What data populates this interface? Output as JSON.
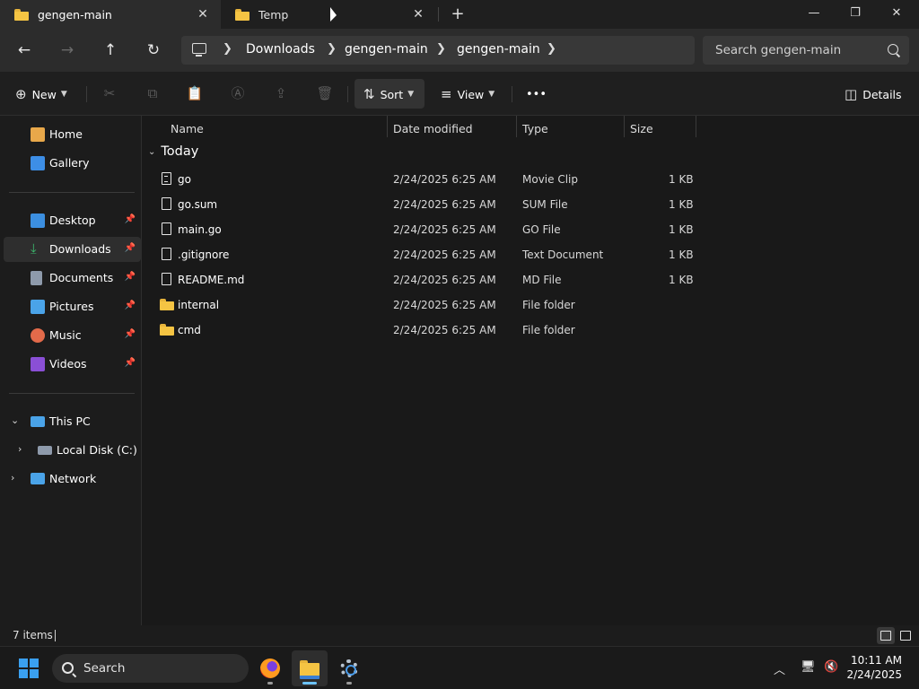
{
  "tabs": [
    {
      "label": "gengen-main",
      "active": true
    },
    {
      "label": "Temp",
      "active": false
    }
  ],
  "window_controls": {
    "minimize": "—",
    "maximize": "❐",
    "close": "✕"
  },
  "nav": {
    "back": "←",
    "forward": "→",
    "up": "↑",
    "refresh": "↻"
  },
  "breadcrumb": [
    "Downloads",
    "gengen-main",
    "gengen-main"
  ],
  "search": {
    "placeholder": "Search gengen-main"
  },
  "commands": {
    "new": "New",
    "sort": "Sort",
    "view": "View",
    "more": "•••",
    "details": "Details"
  },
  "sidebar": {
    "quick": [
      {
        "label": "Home",
        "icon": "home-icon",
        "color": "#e8a84a"
      },
      {
        "label": "Gallery",
        "icon": "gallery-icon",
        "color": "#3d8ee6"
      }
    ],
    "pinned": [
      {
        "label": "Desktop",
        "icon": "desktop-icon",
        "color": "#3c8fe0"
      },
      {
        "label": "Downloads",
        "icon": "downloads-icon",
        "color": "#3cb86d",
        "selected": true
      },
      {
        "label": "Documents",
        "icon": "documents-icon",
        "color": "#8e9aab"
      },
      {
        "label": "Pictures",
        "icon": "pictures-icon",
        "color": "#4aa3e8"
      },
      {
        "label": "Music",
        "icon": "music-icon",
        "color": "#e36a4a"
      },
      {
        "label": "Videos",
        "icon": "videos-icon",
        "color": "#8a4fd6"
      }
    ],
    "this_pc": "This PC",
    "local_disk": "Local Disk (C:)",
    "network": "Network"
  },
  "columns": {
    "name": "Name",
    "date": "Date modified",
    "type": "Type",
    "size": "Size"
  },
  "group": "Today",
  "files": [
    {
      "name": "go",
      "date": "2/24/2025 6:25 AM",
      "type": "Movie Clip",
      "size": "1 KB",
      "kind": "movie"
    },
    {
      "name": "go.sum",
      "date": "2/24/2025 6:25 AM",
      "type": "SUM File",
      "size": "1 KB",
      "kind": "file"
    },
    {
      "name": "main.go",
      "date": "2/24/2025 6:25 AM",
      "type": "GO File",
      "size": "1 KB",
      "kind": "file"
    },
    {
      "name": ".gitignore",
      "date": "2/24/2025 6:25 AM",
      "type": "Text Document",
      "size": "1 KB",
      "kind": "file"
    },
    {
      "name": "README.md",
      "date": "2/24/2025 6:25 AM",
      "type": "MD File",
      "size": "1 KB",
      "kind": "file"
    },
    {
      "name": "internal",
      "date": "2/24/2025 6:25 AM",
      "type": "File folder",
      "size": "",
      "kind": "folder"
    },
    {
      "name": "cmd",
      "date": "2/24/2025 6:25 AM",
      "type": "File folder",
      "size": "",
      "kind": "folder"
    }
  ],
  "status": {
    "items": "7 items"
  },
  "taskbar": {
    "search": "Search",
    "time": "10:11 AM",
    "date": "2/24/2025"
  }
}
